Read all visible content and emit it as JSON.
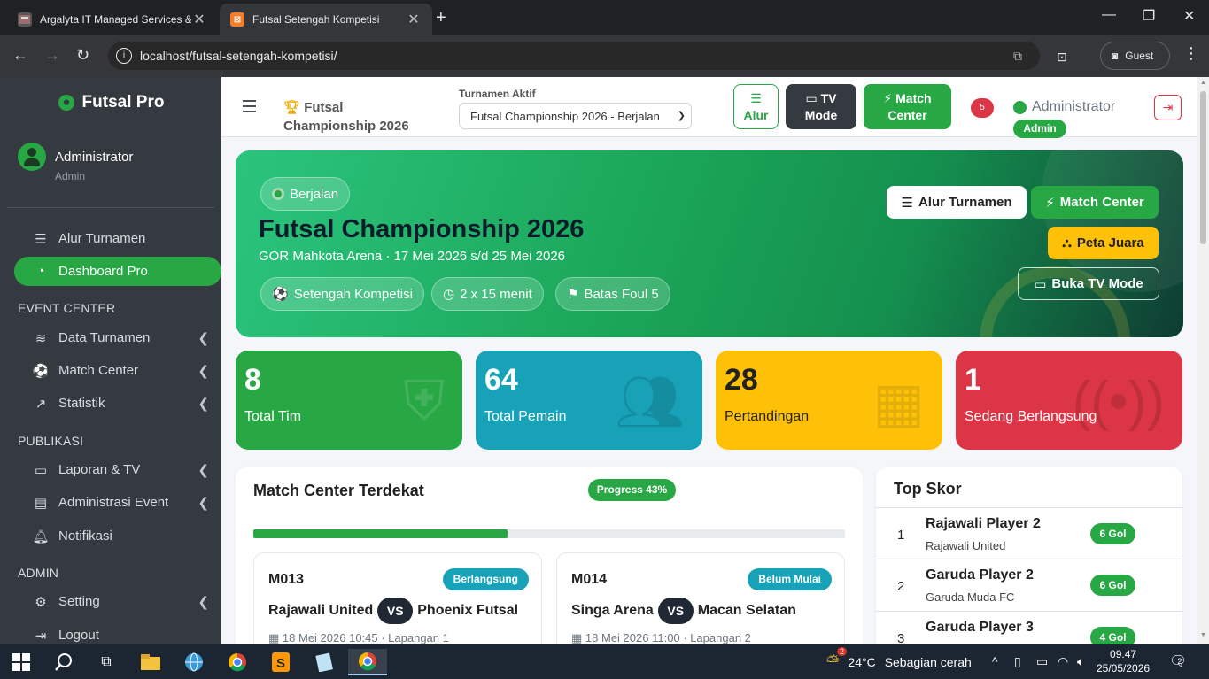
{
  "browser": {
    "tabs": [
      {
        "title": "Argalyta IT Managed Services &",
        "active": false
      },
      {
        "title": "Futsal Setengah Kompetisi",
        "active": true
      }
    ],
    "url": "localhost/futsal-setengah-kompetisi/",
    "profile": "Guest"
  },
  "sidebar": {
    "brand": "Futsal Pro",
    "user_name": "Administrator",
    "user_role": "Admin",
    "items": [
      {
        "label": "Alur Turnamen"
      },
      {
        "label": "Dashboard Pro"
      },
      {
        "label": "Data Turnamen"
      },
      {
        "label": "Match Center"
      },
      {
        "label": "Statistik"
      },
      {
        "label": "Laporan & TV"
      },
      {
        "label": "Administrasi Event"
      },
      {
        "label": "Notifikasi"
      },
      {
        "label": "Setting"
      },
      {
        "label": "Logout"
      }
    ],
    "sections": [
      "EVENT CENTER",
      "PUBLIKASI",
      "ADMIN"
    ]
  },
  "header": {
    "title": "Futsal Championship 2026",
    "turnamen_label": "Turnamen Aktif",
    "turnamen_value": "Futsal Championship 2026 - Berjalan",
    "btn_alur": "Alur",
    "btn_tv_1": "TV",
    "btn_tv_2": "Mode",
    "btn_mc_1": "Match",
    "btn_mc_2": "Center",
    "notif_count": "5",
    "admin_name": "Administrator",
    "admin_badge": "Admin"
  },
  "hero": {
    "status": "Berjalan",
    "title": "Futsal Championship 2026",
    "subtitle": "GOR Mahkota Arena · 17 Mei 2026 s/d 25 Mei 2026",
    "pill_format": "Setengah Kompetisi",
    "pill_duration": "2 x 15 menit",
    "pill_foul": "Batas Foul 5",
    "btn_alur": "Alur Turnamen",
    "btn_mc": "Match Center",
    "btn_peta": "Peta Juara",
    "btn_tv": "Buka TV Mode"
  },
  "stats": [
    {
      "value": "8",
      "label": "Total Tim"
    },
    {
      "value": "64",
      "label": "Total Pemain"
    },
    {
      "value": "28",
      "label": "Pertandingan"
    },
    {
      "value": "1",
      "label": "Sedang Berlangsung"
    }
  ],
  "match_center": {
    "title": "Match Center Terdekat",
    "progress_label": "Progress 43%",
    "progress": 43,
    "matches": [
      {
        "code": "M013",
        "status": "Berlangsung",
        "home": "Rajawali United",
        "vs": "VS",
        "away": "Phoenix Futsal",
        "meta": "18 Mei 2026 10:45 · Lapangan 1"
      },
      {
        "code": "M014",
        "status": "Belum Mulai",
        "home": "Singa Arena",
        "vs": "VS",
        "away": "Macan Selatan",
        "meta": "18 Mei 2026 11:00 · Lapangan 2"
      }
    ]
  },
  "top_skor": {
    "title": "Top Skor",
    "rows": [
      {
        "rank": "1",
        "name": "Rajawali Player 2",
        "team": "Rajawali United",
        "goals": "6 Gol"
      },
      {
        "rank": "2",
        "name": "Garuda Player 2",
        "team": "Garuda Muda FC",
        "goals": "6 Gol"
      },
      {
        "rank": "3",
        "name": "Garuda Player 3",
        "team": "",
        "goals": "4 Gol"
      }
    ]
  },
  "taskbar": {
    "weather_temp": "24°C",
    "weather_desc": "Sebagian cerah",
    "weather_badge": "2",
    "time": "09.47",
    "date": "25/05/2026",
    "notif_count": "2"
  }
}
